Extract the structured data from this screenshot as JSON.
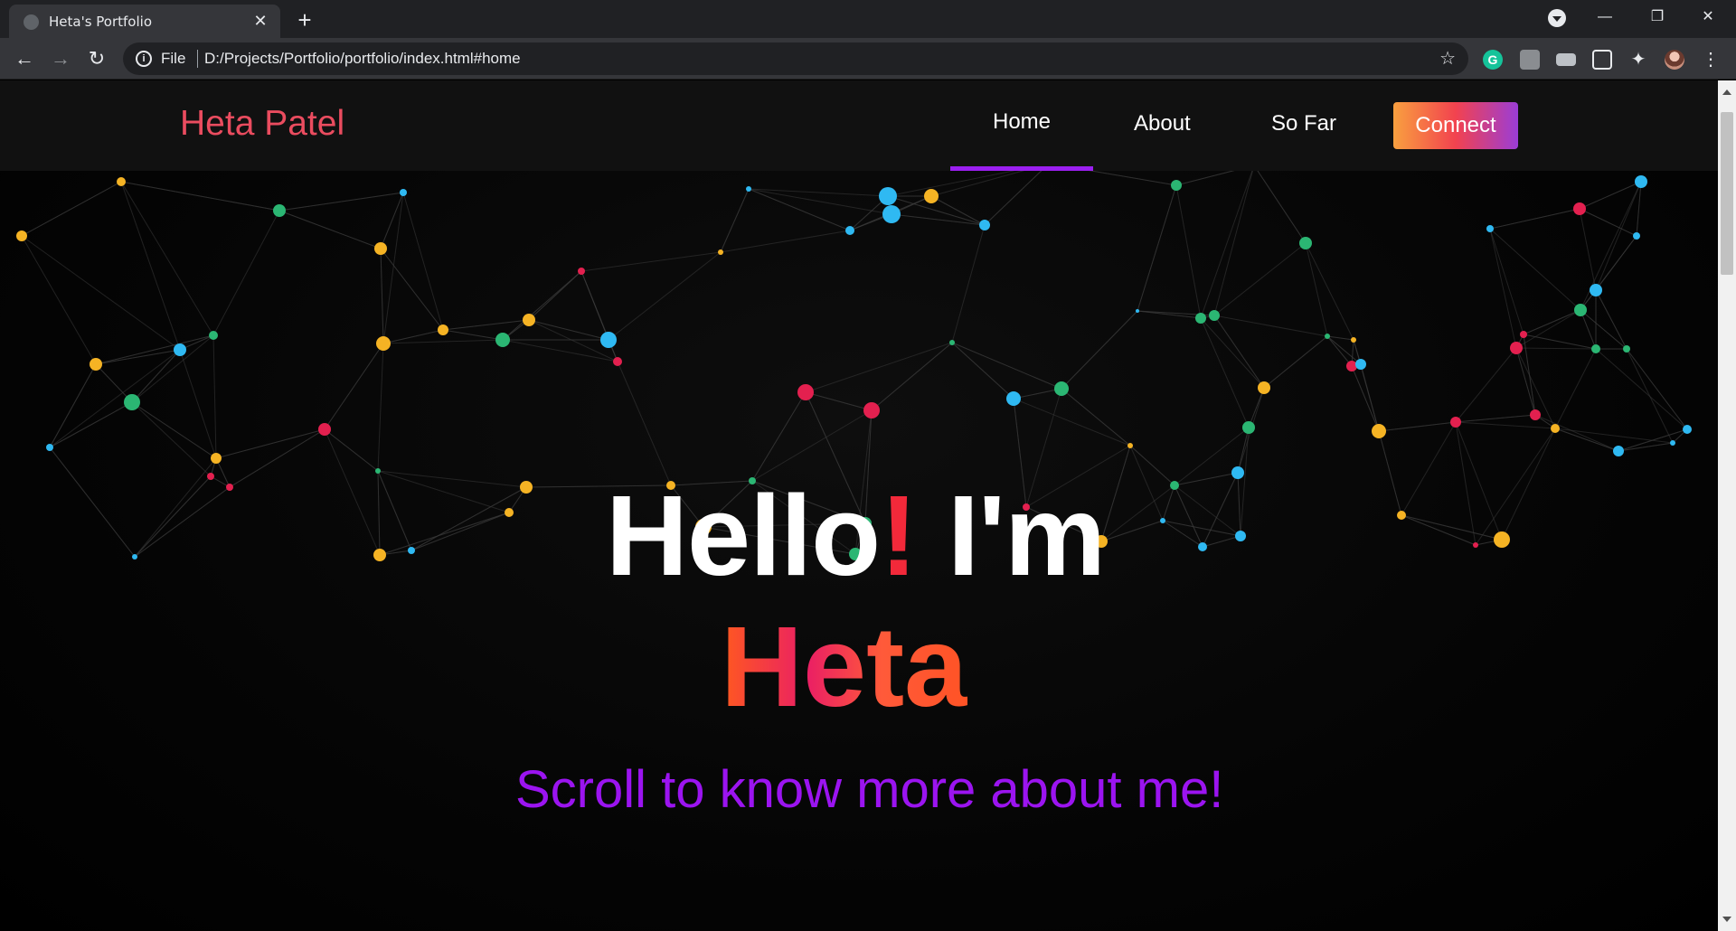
{
  "browser": {
    "tab_title": "Heta's Portfolio",
    "url_scheme": "File",
    "url": "D:/Projects/Portfolio/portfolio/index.html#home"
  },
  "site": {
    "brand": "Heta Patel",
    "nav": {
      "home": "Home",
      "about": "About",
      "so_far": "So Far",
      "connect": "Connect"
    },
    "hero": {
      "greeting": "Hello",
      "exclamation": "!",
      "im": " I'm",
      "name": "Heta",
      "tagline": "Scroll to know more about me!"
    }
  },
  "colors": {
    "brand": "#ea4c5f",
    "active_underline": "#9b1ff0",
    "tagline": "#9b14f0",
    "dot_yellow": "#f5b324",
    "dot_blue": "#2fb9f2",
    "dot_green": "#2bb673",
    "dot_red": "#e3204f"
  },
  "icons": {
    "back": "arrow-left-icon",
    "forward": "arrow-right-icon",
    "reload": "reload-icon",
    "info": "info-icon",
    "bookmark": "star-icon",
    "extensions": "puzzle-icon",
    "menu": "kebab-menu-icon"
  }
}
